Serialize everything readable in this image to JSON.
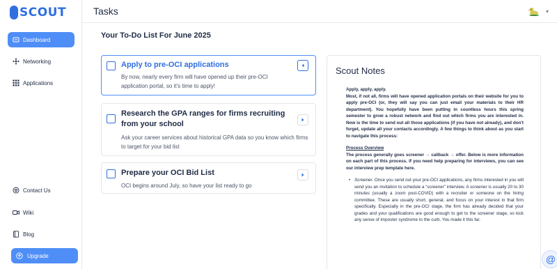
{
  "brand": {
    "logo_text": "SCOUT",
    "color": "#2f6fe0"
  },
  "sidebar": {
    "items": [
      {
        "label": "Dashboard",
        "icon": "dashboard-icon",
        "active": true
      },
      {
        "label": "Networking",
        "icon": "network-icon",
        "active": false
      },
      {
        "label": "Applications",
        "icon": "grid-icon",
        "active": false
      }
    ],
    "bottom_items": [
      {
        "label": "Contact Us",
        "icon": "at-icon"
      },
      {
        "label": "Wiki",
        "icon": "video-icon"
      },
      {
        "label": "Blog",
        "icon": "book-icon"
      }
    ],
    "upgrade_label": "Upgrade"
  },
  "header": {
    "title": "Tasks",
    "avatar_icon": "duck-avatar-icon"
  },
  "main": {
    "heading": "Your To-Do List For June 2025",
    "tasks": [
      {
        "title": "Apply to pre-OCI applications",
        "description": "By now, nearly every firm will have opened up their pre-OCI application portal, so it's time to apply!",
        "checked": false,
        "expanded": true
      },
      {
        "title": "Research the GPA ranges for firms recruiting from your school",
        "description": "Ask your career services about historical GPA data so you know which firms to target for your bid list",
        "checked": false,
        "expanded": false
      },
      {
        "title": "Prepare your OCI Bid List",
        "description": "OCI begins around July, so have your list ready to go",
        "checked": false,
        "expanded": false
      }
    ]
  },
  "notes": {
    "title": "Scout Notes",
    "intro_heading": "Apply, apply, apply.",
    "intro_text": "Most, if not all, firms will have opened application portals on their website for you to apply pre-OCI (or, they will say you can just email your materials to their HR department). You hopefully have been putting in countless hours this spring semester to grow a robust network and find out which firms you are interested in. Now is the time to send out all those applications (if you have not already), and don't forget, update all your contacts accordingly. A few things to think about as you start to navigate this process:",
    "process_heading": "Process Overview",
    "process_text": "The process generally goes screener → callback → offer. Below is more information on each part of this process. If you need help preparing for interviews, you can see our interview prep template here.",
    "bullet_label": "Screener.",
    "bullet_text": "Once you send out your pre-OCI applications, any firms interested in you will send you an invitation to schedule a “screener” interview. A screener is usually 20 to 30 minutes (usually a zoom post-COVID) with a recruiter or someone on the hiring committee. These are usually short, general, and focus on your interest in that firm specifically. Especially in the pre-OCI stage, the firm has already decided that your grades and your qualifications are good enough to get to the screener stage, so kick any sense of imposter syndrome to the curb. You made it this far."
  }
}
